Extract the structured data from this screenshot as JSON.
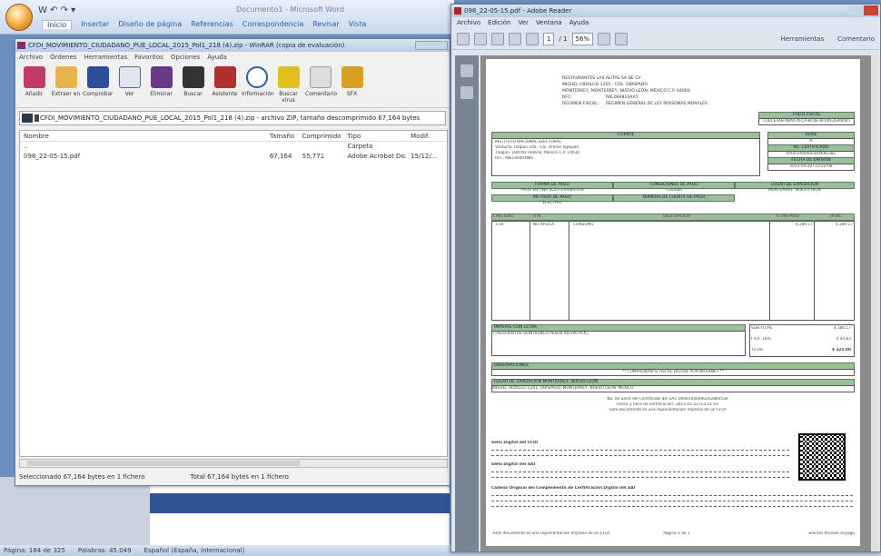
{
  "word": {
    "qat": "W ↶ ↷ ▾",
    "title": "Documento1 - Microsoft Word",
    "tabs": [
      "Inicio",
      "Insertar",
      "Diseño de página",
      "Referencias",
      "Correspondencia",
      "Revisar",
      "Vista"
    ],
    "status": [
      "Página: 184 de 325",
      "Palabras: 45.049",
      "Español (España, internacional)"
    ]
  },
  "winrar": {
    "title": "CFDI_MOVIMIENTO_CIUDADANO_PUE_LOCAL_2015_Pol1_218 (4).zip - WinRAR (copia de evaluación)",
    "menu": [
      "Archivo",
      "Órdenes",
      "Herramientas",
      "Favoritos",
      "Opciones",
      "Ayuda"
    ],
    "tools": [
      "Añadir",
      "Extraer en",
      "Comprobar",
      "Ver",
      "Eliminar",
      "Buscar",
      "Asistente",
      "Información",
      "Buscar virus",
      "Comentario",
      "SFX"
    ],
    "address": "CFDI_MOVIMIENTO_CIUDADANO_PUE_LOCAL_2015_Pol1_218 (4).zip - archivo ZIP, tamaño descomprimido 67,164 bytes",
    "columns": [
      "Nombre",
      "Tamaño",
      "Comprimido",
      "Tipo",
      "Modif."
    ],
    "rows": [
      {
        "name": "..",
        "size": "",
        "packed": "",
        "type": "Carpeta",
        "mod": ""
      },
      {
        "name": "098_22-05-15.pdf",
        "size": "67,164",
        "packed": "55,771",
        "type": "Adobe Acrobat Do...",
        "mod": "15/12/..."
      }
    ],
    "status_left": "Seleccionado 67,164 bytes en 1 fichero",
    "status_right": "Total 67,164 bytes en 1 fichero"
  },
  "reader": {
    "title": "098_22-05-15.pdf - Adobe Reader",
    "menu": [
      "Archivo",
      "Edición",
      "Ver",
      "Ventana",
      "Ayuda"
    ],
    "page_num": "1",
    "page_total": "/ 1",
    "zoom": "56%",
    "links": [
      "Herramientas",
      "Comentario"
    ],
    "doc": {
      "issuer": [
        "RESTAURANTES LAS ALITAS SA DE CV",
        "MIGUEL HIDALGO 1201 · COL. OBISPADO",
        "MONTERREY, MONTERREY, NUEVO LEÓN, MÉXICO C.P. 64060"
      ],
      "rfc_label": "RFC:",
      "rfc": "RAL060810AA7",
      "regime_label": "RÉGIMEN FISCAL:",
      "regime": "RÉGIMEN GENERAL DE LEY PERSONAS MORALES",
      "folio_label": "FOLIO FISCAL",
      "folio": "C0ECE3A8-4BA5-4FCA-BC6E-8C04F2E90D65",
      "client_label": "CLIENTE",
      "client": [
        "INSTITUTO NACIONAL ELECTORAL",
        "Viaducto Tlalpan 100 · Col. Arenal Tepepan",
        "Tlalpan, Distrito Federal, México C.P. 14610",
        "RFC: INE140404NI0"
      ],
      "serie_label": "SERIE",
      "serie": "A",
      "cert_label": "No. CERTIFICADO",
      "cert": "00001000000304691381",
      "date_label": "FECHA DE EMISIÓN",
      "date": "2015-05-22T13:22:08",
      "pay_cols": [
        "FORMA DE PAGO",
        "CONDICIONES DE PAGO",
        "LUGAR DE EXPEDICIÓN"
      ],
      "pay_vals": [
        "PAGO EN UNA SOLA EXHIBICIÓN",
        "Contado",
        "MONTERREY, NUEVO LEÓN"
      ],
      "method_cols": [
        "MÉTODO DE PAGO",
        "NÚMERO DE CUENTA DE PAGO"
      ],
      "method_vals": [
        "EFECTIVO",
        ""
      ],
      "item_cols": [
        "CANTIDAD",
        "U.M.",
        "DESCRIPCIÓN",
        "P. UNITARIO",
        "TOTAL"
      ],
      "item": [
        "1.00",
        "NO APLICA",
        "CONSUMO",
        "$ 280.17",
        "$ 280.17"
      ],
      "amount_label": "IMPORTE CON LETRA",
      "amount_text": "(TRESCIENTOS VEINTICINCO PESOS 00/100 M.N.)",
      "subtotal_label": "SUB-TOTAL",
      "subtotal": "$ 280.17",
      "iva_label": "I.V.A. 16%",
      "iva": "$ 44.83",
      "total_label": "TOTAL",
      "total": "$ 325.00",
      "obs_label": "OBSERVACIONES",
      "obs": "** COMPROBANTE FISCAL DIGITAL POR INTERNET **",
      "place_label": "LUGAR DE EXPEDICIÓN",
      "place": "MONTERREY, NUEVO LEÓN",
      "place_text": "MIGUEL HIDALGO 1201, OBISPADO, MONTERREY, NUEVO LEÓN, MÉXICO",
      "cert_lines": [
        "No. de Serie del Certificado del SAT: 00001000000202864530",
        "Fecha y hora de certificación: 2015-05-22T13:22:10",
        "Este documento es una representación impresa de un CFDI"
      ],
      "sello_label": "Sello Digital del CFDI",
      "sello_sat_label": "Sello Digital del SAT",
      "cadena_label": "Cadena Original del Complemento de Certificación Digital del SAT",
      "footer": [
        "Este documento es una representación impresa de un CFDI",
        "Página 1 de 1",
        "Efectos fiscales al pago"
      ]
    }
  }
}
